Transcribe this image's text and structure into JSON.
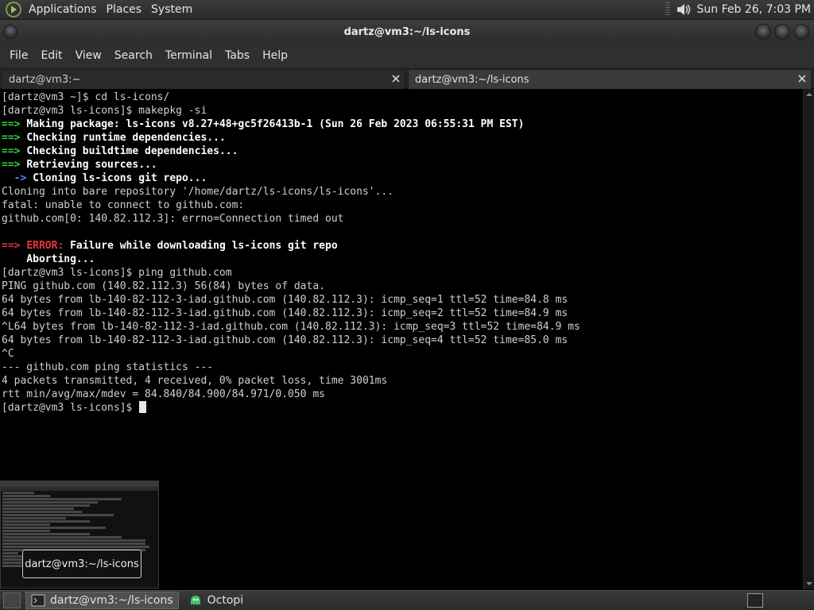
{
  "top_panel": {
    "menus": [
      "Applications",
      "Places",
      "System"
    ],
    "clock": "Sun Feb 26,  7:03 PM"
  },
  "window": {
    "title": "dartz@vm3:~/ls-icons"
  },
  "menubar": [
    "File",
    "Edit",
    "View",
    "Search",
    "Terminal",
    "Tabs",
    "Help"
  ],
  "tabs": [
    {
      "label": "dartz@vm3:~",
      "active": false
    },
    {
      "label": "dartz@vm3:~/ls-icons",
      "active": true
    }
  ],
  "terminal": {
    "lines": [
      [
        {
          "t": "[dartz@vm3 ~]$ cd ls-icons/",
          "c": ""
        }
      ],
      [
        {
          "t": "[dartz@vm3 ls-icons]$ makepkg -si",
          "c": ""
        }
      ],
      [
        {
          "t": "==> ",
          "c": "g"
        },
        {
          "t": "Making package: ls-icons v8.27+48+gc5f26413b-1 (Sun 26 Feb 2023 06:55:31 PM EST)",
          "c": "w"
        }
      ],
      [
        {
          "t": "==> ",
          "c": "g"
        },
        {
          "t": "Checking runtime dependencies...",
          "c": "w"
        }
      ],
      [
        {
          "t": "==> ",
          "c": "g"
        },
        {
          "t": "Checking buildtime dependencies...",
          "c": "w"
        }
      ],
      [
        {
          "t": "==> ",
          "c": "g"
        },
        {
          "t": "Retrieving sources...",
          "c": "w"
        }
      ],
      [
        {
          "t": "  -> ",
          "c": "b"
        },
        {
          "t": "Cloning ls-icons git repo...",
          "c": "w"
        }
      ],
      [
        {
          "t": "Cloning into bare repository '/home/dartz/ls-icons/ls-icons'...",
          "c": ""
        }
      ],
      [
        {
          "t": "fatal: unable to connect to github.com:",
          "c": ""
        }
      ],
      [
        {
          "t": "github.com[0: 140.82.112.3]: errno=Connection timed out",
          "c": ""
        }
      ],
      [
        {
          "t": "",
          "c": ""
        }
      ],
      [
        {
          "t": "==> ",
          "c": "r"
        },
        {
          "t": "ERROR: ",
          "c": "r"
        },
        {
          "t": "Failure while downloading ls-icons git repo",
          "c": "w"
        }
      ],
      [
        {
          "t": "    Aborting...",
          "c": "w"
        }
      ],
      [
        {
          "t": "[dartz@vm3 ls-icons]$ ping github.com",
          "c": ""
        }
      ],
      [
        {
          "t": "PING github.com (140.82.112.3) 56(84) bytes of data.",
          "c": ""
        }
      ],
      [
        {
          "t": "64 bytes from lb-140-82-112-3-iad.github.com (140.82.112.3): icmp_seq=1 ttl=52 time=84.8 ms",
          "c": ""
        }
      ],
      [
        {
          "t": "64 bytes from lb-140-82-112-3-iad.github.com (140.82.112.3): icmp_seq=2 ttl=52 time=84.9 ms",
          "c": ""
        }
      ],
      [
        {
          "t": "^L64 bytes from lb-140-82-112-3-iad.github.com (140.82.112.3): icmp_seq=3 ttl=52 time=84.9 ms",
          "c": ""
        }
      ],
      [
        {
          "t": "64 bytes from lb-140-82-112-3-iad.github.com (140.82.112.3): icmp_seq=4 ttl=52 time=85.0 ms",
          "c": ""
        }
      ],
      [
        {
          "t": "^C",
          "c": ""
        }
      ],
      [
        {
          "t": "--- github.com ping statistics ---",
          "c": ""
        }
      ],
      [
        {
          "t": "4 packets transmitted, 4 received, 0% packet loss, time 3001ms",
          "c": ""
        }
      ],
      [
        {
          "t": "rtt min/avg/max/mdev = 84.840/84.900/84.971/0.050 ms",
          "c": ""
        }
      ],
      [
        {
          "t": "[dartz@vm3 ls-icons]$ ",
          "c": ""
        }
      ]
    ]
  },
  "preview": {
    "tooltip": "dartz@vm3:~/ls-icons"
  },
  "taskbar": {
    "tasks": [
      {
        "label": "dartz@vm3:~/ls-icons",
        "icon": "terminal-icon"
      },
      {
        "label": "Octopi",
        "icon": "octopi-icon"
      }
    ]
  },
  "colors": {
    "prompt_arrow": "#35d23c",
    "sub_arrow": "#4b8cf4",
    "error": "#e8363b"
  }
}
